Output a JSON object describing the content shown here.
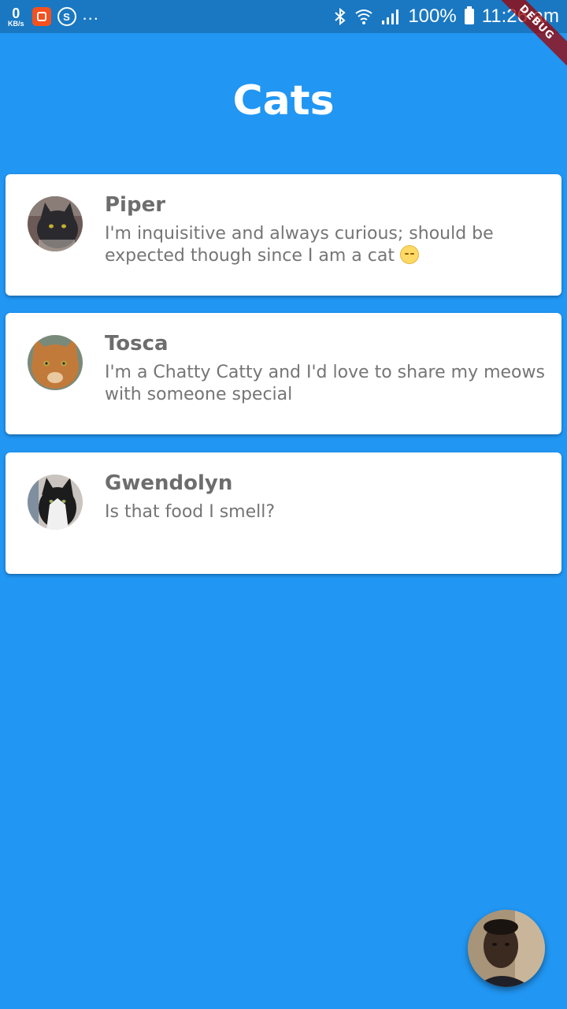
{
  "status_bar": {
    "speed_value": "0",
    "speed_unit": "KB/s",
    "s_icon_letter": "S",
    "more": "...",
    "battery_pct": "100%",
    "time": "11:26 am"
  },
  "debug_banner": "DEBUG",
  "page_title": "Cats",
  "cats": [
    {
      "name": "Piper",
      "description": "I'm inquisitive and always curious; should be expected though since I am a cat",
      "emoji": "smirking-face"
    },
    {
      "name": "Tosca",
      "description": "I'm a Chatty Catty and I'd love to share my meows with someone special"
    },
    {
      "name": "Gwendolyn",
      "description": "Is that food I smell?"
    }
  ],
  "colors": {
    "background": "#2196F3",
    "status_bar": "#1a78c2",
    "card": "#ffffff",
    "name_text": "#6d6d6d",
    "desc_text": "#757575"
  }
}
